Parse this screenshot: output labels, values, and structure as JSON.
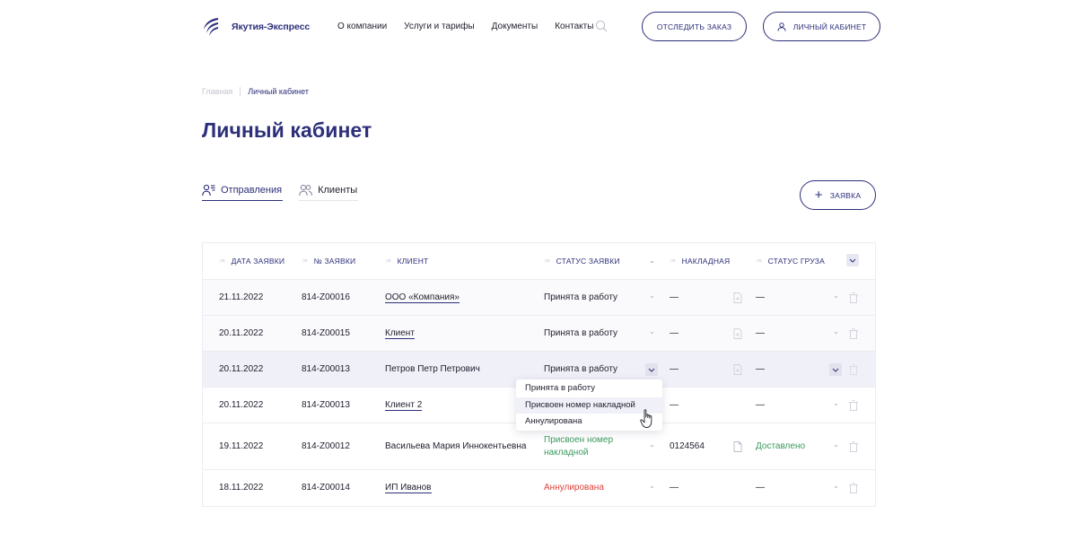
{
  "header": {
    "logo_text": "Якутия-Экспресс",
    "nav": [
      "О компании",
      "Услуги и тарифы",
      "Документы",
      "Контакты"
    ],
    "track_button": "ОТСЛЕДИТЬ ЗАКАЗ",
    "cabinet_button": "ЛИЧНЫЙ КАБИНЕТ"
  },
  "breadcrumb": {
    "home": "Главная",
    "current": "Личный кабинет"
  },
  "page_title": "Личный кабинет",
  "tabs": [
    {
      "label": "Отправления",
      "icon": "user-list-icon",
      "active": true
    },
    {
      "label": "Клиенты",
      "icon": "users-icon",
      "active": false
    }
  ],
  "request_button": "ЗАЯВКА",
  "table": {
    "columns": [
      "ДАТА ЗАЯВКИ",
      "№ ЗАЯВКИ",
      "КЛИЕНТ",
      "СТАТУС ЗАЯВКИ",
      "НАКЛАДНАЯ",
      "СТАТУС ГРУЗА"
    ],
    "rows": [
      {
        "date": "21.11.2022",
        "number": "814-Z00016",
        "client": "ООО «Компания»",
        "status": "Принята в работу",
        "invoice": "—",
        "cargo": "—"
      },
      {
        "date": "20.11.2022",
        "number": "814-Z00015",
        "client": "Клиент",
        "status": "Принята в работу",
        "invoice": "—",
        "cargo": "—"
      },
      {
        "date": "20.11.2022",
        "number": "814-Z00013",
        "client": "Петров Петр Петрович",
        "status": "Принята в работу",
        "invoice": "—",
        "cargo": "—"
      },
      {
        "date": "20.11.2022",
        "number": "814-Z00013",
        "client": "Клиент 2",
        "status": "",
        "invoice": "—",
        "cargo": "—"
      },
      {
        "date": "19.11.2022",
        "number": "814-Z00012",
        "client": "Васильева Мария Иннокентьевна",
        "status": "Присвоен номер накладной",
        "invoice": "0124564",
        "cargo": "Доставлено"
      },
      {
        "date": "18.11.2022",
        "number": "814-Z00014",
        "client": "ИП Иванов",
        "status": "Аннулирована",
        "invoice": "—",
        "cargo": "—"
      }
    ]
  },
  "status_dropdown": {
    "options": [
      "Принята в работу",
      "Присвоен номер накладной",
      "Аннулирована"
    ],
    "hovered": "Присвоен номер накладной"
  },
  "colors": {
    "brand": "#2d2f7a",
    "status_green": "#3b9a5e",
    "status_red": "#e0413b"
  }
}
